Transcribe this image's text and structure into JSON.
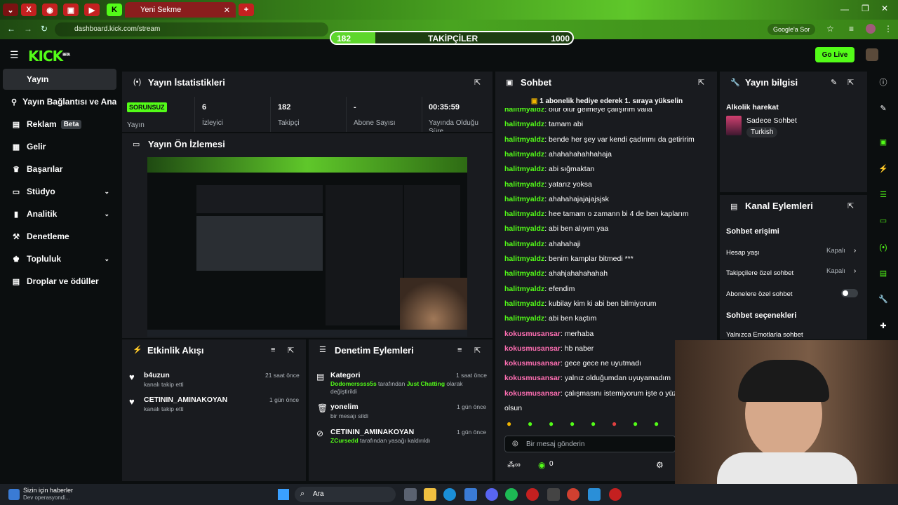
{
  "browser": {
    "tab_title": "Yeni Sekme",
    "url": "dashboard.kick.com/stream",
    "google_lens": "Google'a Sor"
  },
  "follower_goal": {
    "current": "182",
    "label": "TAKİPÇİLER",
    "target": "1000",
    "progress": 0.182
  },
  "header": {
    "logo": "KICK",
    "logo_sup": "BETA",
    "go_live": "Go Live"
  },
  "sidebar": {
    "items": [
      {
        "label": "Yayın",
        "icon": "broadcast-icon"
      },
      {
        "label": "Yayın Bağlantısı ve Anahtarı",
        "icon": "link-icon"
      },
      {
        "label": "Reklam",
        "badge": "Beta",
        "icon": "ad-icon"
      },
      {
        "label": "Gelir",
        "icon": "dollar-icon"
      },
      {
        "label": "Başarılar",
        "icon": "trophy-icon"
      },
      {
        "label": "Stüdyo",
        "icon": "studio-icon"
      },
      {
        "label": "Analitik",
        "icon": "chart-icon"
      },
      {
        "label": "Denetleme",
        "icon": "hammer-icon"
      },
      {
        "label": "Topluluk",
        "icon": "community-icon"
      },
      {
        "label": "Droplar ve ödüller",
        "icon": "gift-icon"
      }
    ]
  },
  "stats": {
    "title": "Yayın İstatistikleri",
    "status": "SORUNSUZ",
    "status_label": "Yayın",
    "viewers": "6",
    "viewers_label": "İzleyici",
    "followers": "182",
    "followers_label": "Takipçi",
    "subs": "-",
    "subs_label": "Abone Sayısı",
    "uptime": "00:35:59",
    "uptime_label": "Yayında Olduğu Süre"
  },
  "preview": {
    "title": "Yayın Ön İzlemesi"
  },
  "activity": {
    "title": "Etkinlik Akışı",
    "items": [
      {
        "user": "b4uzun",
        "desc": "kanalı takip etti",
        "time": "21 saat önce"
      },
      {
        "user": "CETININ_AMINAKOYAN",
        "desc": "kanalı takip etti",
        "time": "1 gün önce"
      }
    ]
  },
  "moderation": {
    "title": "Denetim Eylemleri",
    "items": [
      {
        "title": "Kategori",
        "line1_user": "Dodomerssss5s",
        "line1_mid": "tarafından",
        "line1_cat": "Just Chatting",
        "line1_end": "olarak",
        "line2": "değiştirildi",
        "time": "1 saat önce"
      },
      {
        "title": "yonelim",
        "line1": "bir mesajı sildi",
        "time": "1 gün önce"
      },
      {
        "title": "CETININ_AMINAKOYAN",
        "line1_user": "ZCursedd",
        "line1_rest": "tarafından yasağı kaldırıldı",
        "time": "1 gün önce"
      }
    ]
  },
  "chat": {
    "title": "Sohbet",
    "banner": "1 abonelik hediye ederek 1. sıraya yükselin",
    "messages": [
      {
        "user": "halitmyaldz",
        "text": "olur olur gelmeye çalışırım valla"
      },
      {
        "user": "halitmyaldz",
        "text": "tamam abi"
      },
      {
        "user": "halitmyaldz",
        "text": "bende her şey var kendi çadırımı da getiririm"
      },
      {
        "user": "halitmyaldz",
        "text": "ahahahahahhahaja"
      },
      {
        "user": "halitmyaldz",
        "text": "abi sığmaktan"
      },
      {
        "user": "halitmyaldz",
        "text": "yatarız yoksa"
      },
      {
        "user": "halitmyaldz",
        "text": "ahahahajajajajsjsk"
      },
      {
        "user": "halitmyaldz",
        "text": "hee tamam o zamann bi 4 de ben kaplarım"
      },
      {
        "user": "halitmyaldz",
        "text": "abi ben alıyım yaa"
      },
      {
        "user": "halitmyaldz",
        "text": "ahahahaji"
      },
      {
        "user": "halitmyaldz",
        "text": "benim kamplar bitmedi ***"
      },
      {
        "user": "halitmyaldz",
        "text": "ahahjahahahahah"
      },
      {
        "user": "halitmyaldz",
        "text": "efendim"
      },
      {
        "user": "halitmyaldz",
        "text": "kubilay kim ki abi ben bilmiyorum"
      },
      {
        "user": "halitmyaldz",
        "text": "abi ben kaçtım"
      },
      {
        "user": "kokusmusansar",
        "text": "merhaba"
      },
      {
        "user": "kokusmusansar",
        "text": "hb naber"
      },
      {
        "user": "kokusmusansar",
        "text": "gece gece ne uyutmadı"
      },
      {
        "user": "kokusmusansar",
        "text": "yalnız olduğumdan uyuyamadım"
      },
      {
        "user": "kokusmusansar",
        "text": "çalışmasını istemiyorum işte o yüzden"
      },
      {
        "user": "",
        "text": "olsun"
      }
    ],
    "input_placeholder": "Bir mesaj gönderin",
    "count": "0"
  },
  "stream_info": {
    "title": "Yayın bilgisi",
    "stream_title": "Alkolik harekat",
    "category": "Sadece Sohbet",
    "language": "Turkish"
  },
  "channel_actions": {
    "title": "Kanal Eylemleri",
    "section1": "Sohbet erişimi",
    "rows": [
      {
        "label": "Hesap yaşı",
        "value": "Kapalı"
      },
      {
        "label": "Takipçilere özel sohbet",
        "value": "Kapalı"
      },
      {
        "label": "Abonelere özel sohbet",
        "value": ""
      }
    ],
    "section2": "Sohbet seçenekleri",
    "row_partial": "Yalnızca Emotlarla sohbet"
  },
  "taskbar": {
    "news_title": "Sizin için haberler",
    "news_sub": "Dev operasyondi...",
    "search": "Ara"
  },
  "colors": {
    "kick_green": "#53fc18",
    "panel": "#191b1f",
    "bg": "#0b0e0f"
  }
}
